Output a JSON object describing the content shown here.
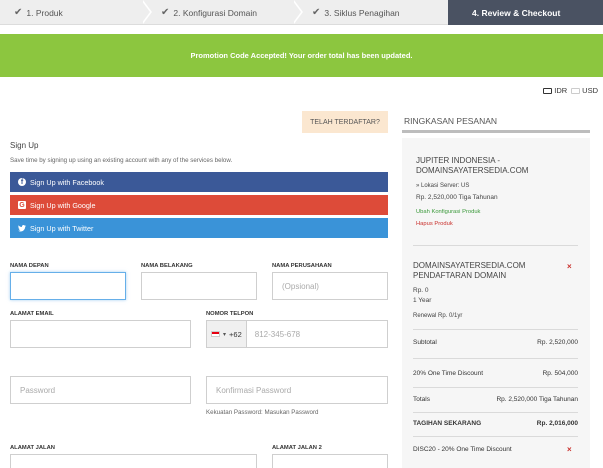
{
  "steps": [
    {
      "label": "1. Produk"
    },
    {
      "label": "2. Konfigurasi Domain"
    },
    {
      "label": "3. Siklus Penagihan"
    },
    {
      "label": "4. Review & Checkout"
    }
  ],
  "alert": {
    "message": "Promotion Code Accepted! Your order total has been updated."
  },
  "currency": {
    "options": [
      "IDR",
      "USD"
    ],
    "selected": "IDR"
  },
  "login_tab": {
    "label": "TELAH TERDAFTAR?"
  },
  "signup": {
    "title": "Sign Up",
    "description": "Save time by signing up using an existing account with any of the services below.",
    "facebook": "Sign Up with Facebook",
    "google": "Sign Up with Google",
    "twitter": "Sign Up with Twitter"
  },
  "form": {
    "first_name_label": "NAMA DEPAN",
    "last_name_label": "NAMA BELAKANG",
    "company_label": "NAMA PERUSAHAAN",
    "company_placeholder": "(Opsional)",
    "email_label": "ALAMAT EMAIL",
    "phone_label": "NOMOR TELPON",
    "phone_code": "+62",
    "phone_placeholder": "812-345-678",
    "password_placeholder": "Password",
    "confirm_placeholder": "Konfirmasi Password",
    "strength_hint": "Kekuatan Password: Masukan Password",
    "address1_label": "ALAMAT JALAN",
    "address2_label": "ALAMAT JALAN 2"
  },
  "summary": {
    "title": "RINGKASAN PESANAN",
    "item1": {
      "name": "JUPITER INDONESIA - DOMAINSAYATERSEDIA.COM",
      "location": "» Lokasi Server: US",
      "price": "Rp. 2,520,000 Tiga Tahunan",
      "edit": "Ubah Konfigurasi Produk",
      "remove": "Hapus Produk"
    },
    "item2": {
      "name": "DOMAINSAYATERSEDIA.COM PENDAFTARAN DOMAIN",
      "price": "Rp. 0",
      "period": "1 Year",
      "renewal": "Renewal Rp. 0/1yr"
    },
    "subtotal_label": "Subtotal",
    "subtotal_value": "Rp. 2,520,000",
    "discount_label": "20% One Time Discount",
    "discount_value": "Rp. 504,000",
    "totals_label": "Totals",
    "totals_value": "Rp. 2,520,000 Tiga Tahunan",
    "due_label": "TAGIHAN SEKARANG",
    "due_value": "Rp. 2,016,000",
    "promo": "DISC20 - 20% One Time Discount"
  }
}
